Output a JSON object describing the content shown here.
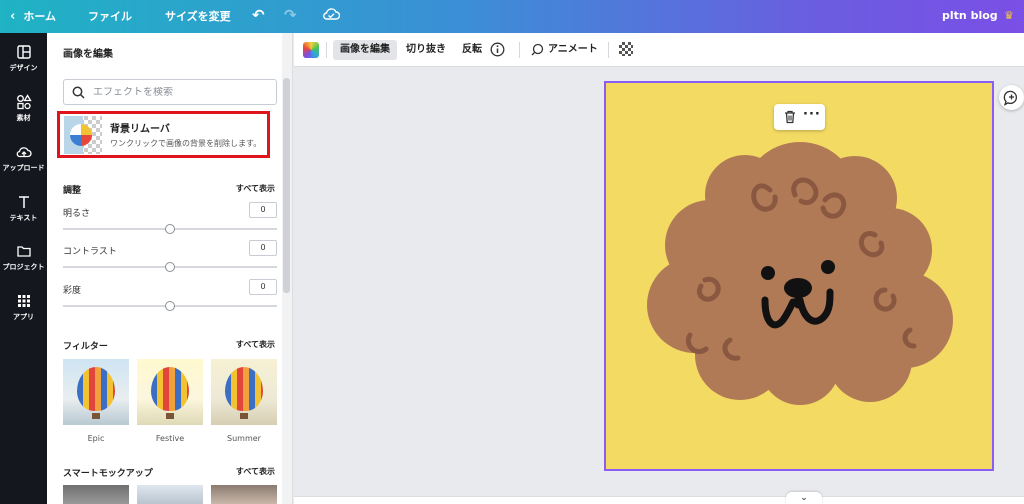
{
  "topbar": {
    "home_label": "ホーム",
    "file_label": "ファイル",
    "resize_label": "サイズを変更",
    "project_name": "pltn blog",
    "accent_start": "#1fb3c4",
    "accent_end": "#7a4fe6"
  },
  "rail": {
    "items": [
      {
        "label": "デザイン",
        "icon": "layout-icon"
      },
      {
        "label": "素材",
        "icon": "shapes-icon"
      },
      {
        "label": "アップロード",
        "icon": "cloud-upload-icon"
      },
      {
        "label": "テキスト",
        "icon": "text-icon"
      },
      {
        "label": "プロジェクト",
        "icon": "folder-icon"
      },
      {
        "label": "アプリ",
        "icon": "apps-grid-icon"
      }
    ]
  },
  "panel": {
    "title": "画像を編集",
    "search_placeholder": "エフェクトを検索",
    "bg_remover": {
      "title": "背景リムーバ",
      "description": "ワンクリックで画像の背景を削除します。"
    },
    "adjust": {
      "heading": "調整",
      "see_all": "すべて表示",
      "items": [
        {
          "label": "明るさ",
          "value": "0",
          "level": 0.5
        },
        {
          "label": "コントラスト",
          "value": "0",
          "level": 0.5
        },
        {
          "label": "彩度",
          "value": "0",
          "level": 0.5
        }
      ]
    },
    "filters": {
      "heading": "フィルター",
      "see_all": "すべて表示",
      "items": [
        {
          "label": "Epic"
        },
        {
          "label": "Festive"
        },
        {
          "label": "Summer"
        }
      ]
    },
    "mockups": {
      "heading": "スマートモックアップ",
      "see_all": "すべて表示"
    }
  },
  "toolbar": {
    "edit_image": "画像を編集",
    "crop": "切り抜き",
    "flip": "反転",
    "animate": "アニメート"
  },
  "canvas": {
    "page_color": "#f3da62",
    "selection_color": "#8b5cf6",
    "dog_color": "#b07a57"
  }
}
